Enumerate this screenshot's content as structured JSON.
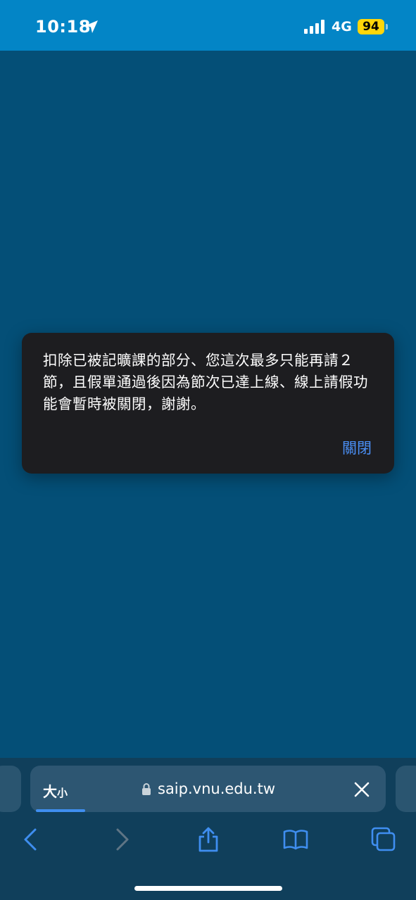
{
  "status_bar": {
    "time": "10:18",
    "network": "4G",
    "battery": "94"
  },
  "alert": {
    "message": "扣除已被記曠課的部分、您這次最多只能再請２節，且假單通過後因為節次已達上線、線上請假功能會暫時被關閉，謝謝。",
    "close_label": "關閉"
  },
  "browser": {
    "aa_big": "大",
    "aa_small": "小",
    "url": "saip.vnu.edu.tw"
  },
  "colors": {
    "status_bar": "#0385c6",
    "page_bg": "#044f77",
    "alert_bg": "#1d1d20",
    "accent": "#4a8ff5",
    "battery": "#ffd60a"
  }
}
